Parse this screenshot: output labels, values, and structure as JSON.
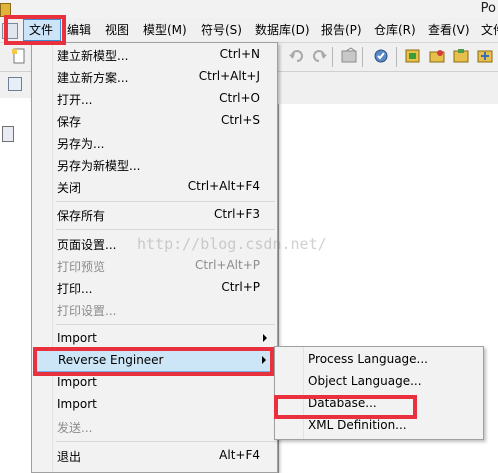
{
  "window": {
    "title_fragment": "Po"
  },
  "menubar": {
    "items": [
      {
        "label": "文件"
      },
      {
        "label": "编辑"
      },
      {
        "label": "视图"
      },
      {
        "label": "模型(M)"
      },
      {
        "label": "符号(S)"
      },
      {
        "label": "数据库(D)"
      },
      {
        "label": "报告(P)"
      },
      {
        "label": "仓库(R)"
      },
      {
        "label": "查看(V)"
      },
      {
        "label": "文件"
      }
    ]
  },
  "file_menu": {
    "items": [
      {
        "label": "建立新模型...",
        "shortcut": "Ctrl+N"
      },
      {
        "label": "建立新方案...",
        "shortcut": "Ctrl+Alt+J"
      },
      {
        "label": "打开...",
        "shortcut": "Ctrl+O"
      },
      {
        "label": "保存",
        "shortcut": "Ctrl+S"
      },
      {
        "label": "另存为..."
      },
      {
        "label": "另存为新模型..."
      },
      {
        "label": "关闭",
        "shortcut": "Ctrl+Alt+F4"
      },
      {
        "label": "保存所有",
        "shortcut": "Ctrl+F3"
      },
      {
        "label": "页面设置..."
      },
      {
        "label": "打印预览",
        "shortcut": "Ctrl+Alt+P"
      },
      {
        "label": "打印...",
        "shortcut": "Ctrl+P"
      },
      {
        "label": "打印设置..."
      },
      {
        "label": "Import"
      },
      {
        "label": "Reverse Engineer"
      },
      {
        "label": "Import"
      },
      {
        "label": "Import"
      },
      {
        "label": "发送..."
      },
      {
        "label": "退出",
        "shortcut": "Alt+F4"
      }
    ]
  },
  "reverse_engineer_submenu": {
    "items": [
      {
        "label": "Process Language..."
      },
      {
        "label": "Object Language..."
      },
      {
        "label": "Database..."
      },
      {
        "label": "XML Definition..."
      }
    ]
  },
  "watermark": {
    "text": "http://blog.csdn.net/"
  },
  "colors": {
    "annotation_red": "#e8313c",
    "menu_highlight": "#cde6f7",
    "menu_highlight_border": "#78aee5"
  }
}
